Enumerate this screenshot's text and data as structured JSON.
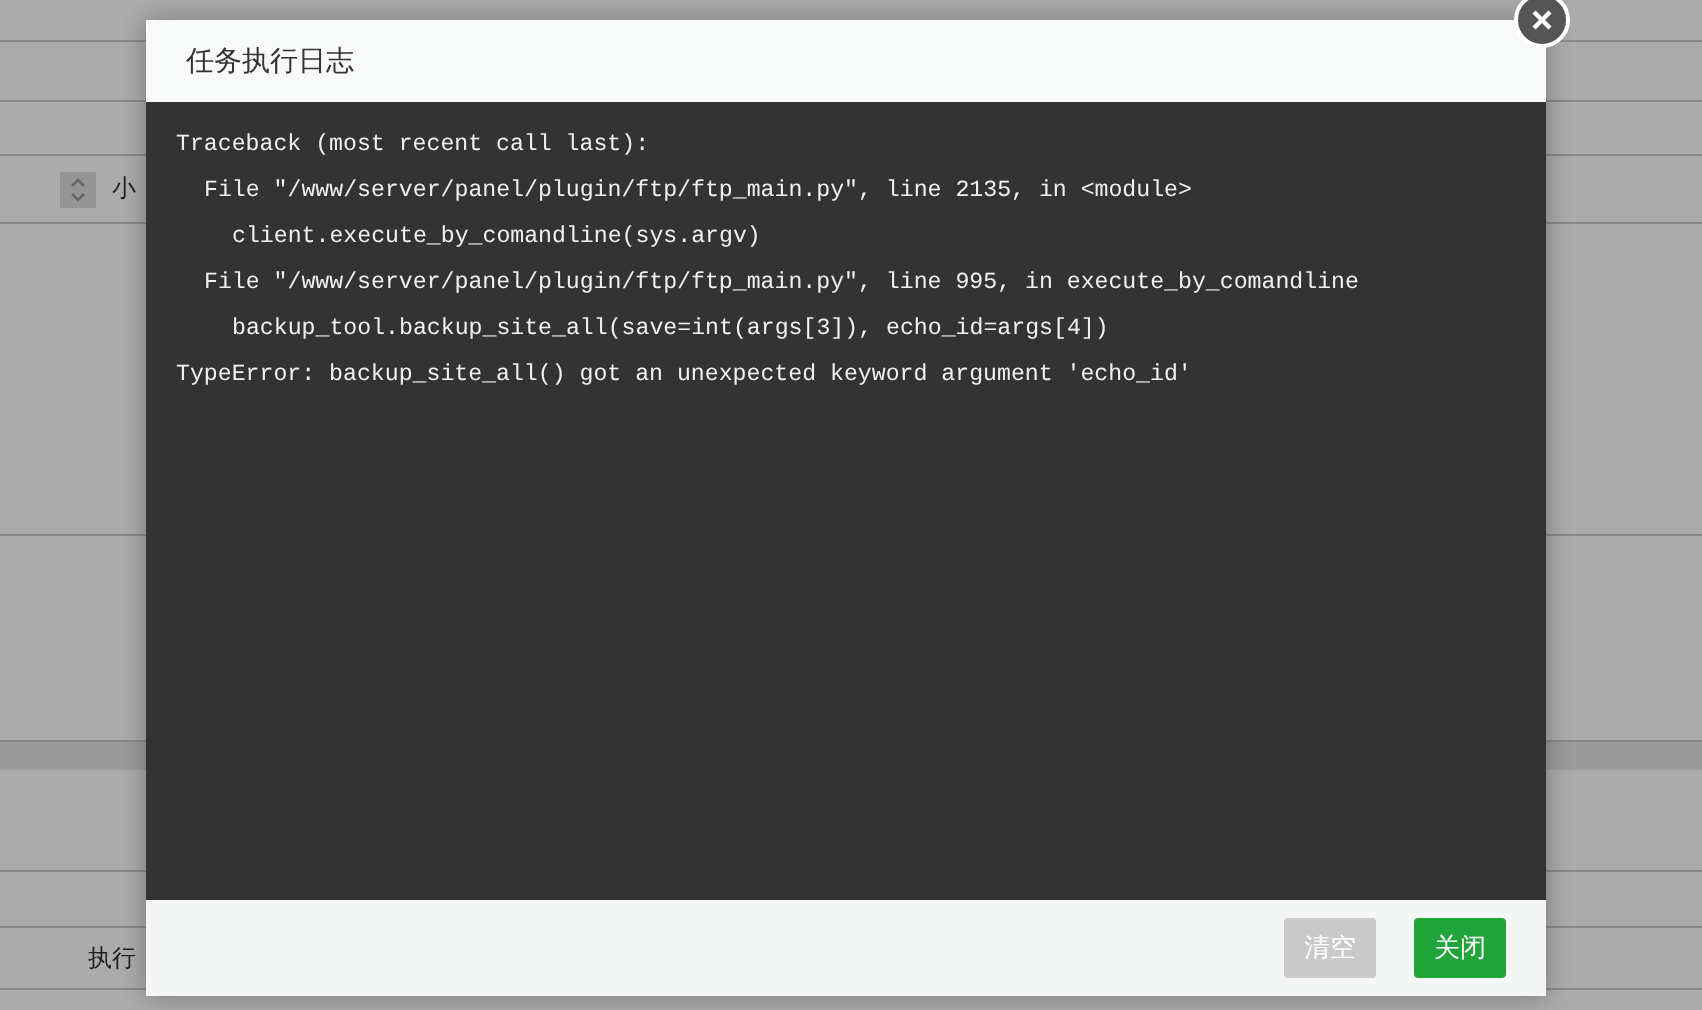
{
  "background": {
    "row_label": "小",
    "footer_label": "执行"
  },
  "dialog": {
    "title": "任务执行日志",
    "log": [
      {
        "kind": "header",
        "text": "Traceback (most recent call last):"
      },
      {
        "kind": "frame",
        "text": "File \"/www/server/panel/plugin/ftp/ftp_main.py\", line 2135, in <module>"
      },
      {
        "kind": "code",
        "text": "client.execute_by_comandline(sys.argv)"
      },
      {
        "kind": "frame",
        "text": "File \"/www/server/panel/plugin/ftp/ftp_main.py\", line 995, in execute_by_comandline"
      },
      {
        "kind": "code",
        "text": "backup_tool.backup_site_all(save=int(args[3]), echo_id=args[4])"
      },
      {
        "kind": "error",
        "text": "TypeError: backup_site_all() got an unexpected keyword argument 'echo_id'"
      }
    ],
    "buttons": [
      {
        "label": "清空",
        "kind": "secondary"
      },
      {
        "label": "关闭",
        "kind": "primary"
      }
    ]
  }
}
